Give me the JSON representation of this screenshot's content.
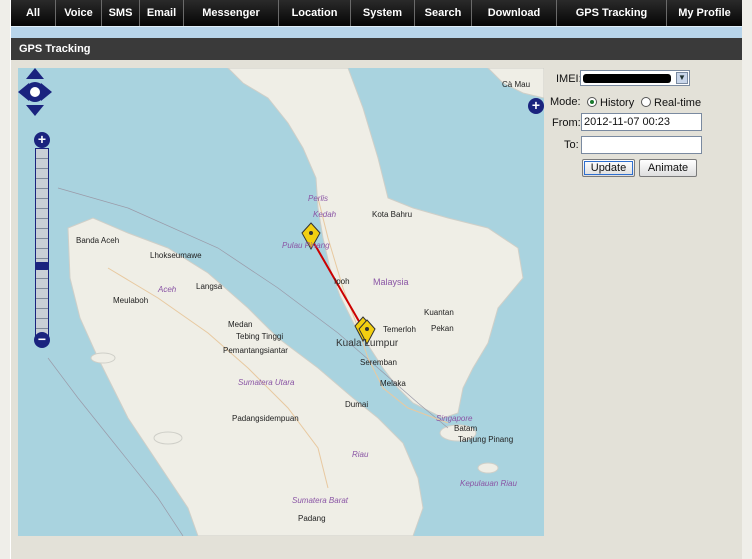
{
  "nav": {
    "items": [
      {
        "label": "All"
      },
      {
        "label": "Voice"
      },
      {
        "label": "SMS"
      },
      {
        "label": "Email"
      },
      {
        "label": "Messenger"
      },
      {
        "label": "Location"
      },
      {
        "label": "System"
      },
      {
        "label": "Search"
      },
      {
        "label": "Download"
      },
      {
        "label": "GPS Tracking"
      },
      {
        "label": "My Profile"
      }
    ]
  },
  "panel": {
    "title": "GPS Tracking"
  },
  "map": {
    "places": {
      "ca_mau": "Cà Mau",
      "kedah": "Kedah",
      "perlis": "Perlis",
      "kota_bahru": "Kota Bahru",
      "banda_aceh": "Banda Aceh",
      "lhokseumawe": "Lhokseumawe",
      "aceh": "Aceh",
      "pulau_pinang": "Pulau Pinang",
      "ipoh": "Ipoh",
      "malaysia": "Malaysia",
      "meulaboh": "Meulaboh",
      "langsa": "Langsa",
      "medan": "Medan",
      "tebing_tinggi": "Tebing Tinggi",
      "pematangsiantar": "Pemantangsiantar",
      "terengganu": "Temerloh",
      "kuantan": "Kuantan",
      "pekan": "Pekan",
      "kuala_lumpur": "Kuala Lumpur",
      "seremban": "Seremban",
      "melaka": "Melaka",
      "sumatera_utara": "Sumatera Utara",
      "dumai": "Dumai",
      "padangsidempuan": "Padangsidempuan",
      "singapore": "Singapore",
      "batam": "Batam",
      "tanjung_pinang": "Tanjung Pinang",
      "riau": "Riau",
      "kepulauan_riau": "Kepulauan Riau",
      "sumatera_barat": "Sumatera Barat",
      "padang": "Padang"
    },
    "colors": {
      "water": "#a9d3df",
      "land": "#efeee6",
      "track": "#cc0000",
      "marker": "#f2cf10"
    }
  },
  "form": {
    "imei_label": "IMEI:",
    "mode_label": "Mode:",
    "mode_history": "History",
    "mode_realtime": "Real-time",
    "mode_selected": "History",
    "from_label": "From:",
    "from_value": "2012-11-07 00:23",
    "to_label": "To:",
    "to_value": "",
    "update_label": "Update",
    "animate_label": "Animate"
  }
}
